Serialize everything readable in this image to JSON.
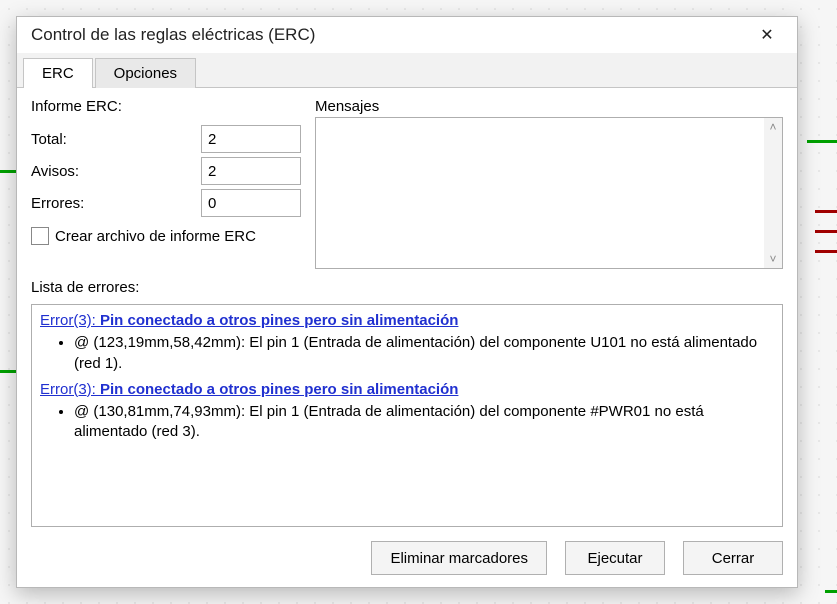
{
  "window": {
    "title": "Control de las reglas eléctricas (ERC)"
  },
  "tabs": {
    "erc": "ERC",
    "opciones": "Opciones"
  },
  "report": {
    "legend": "Informe ERC:",
    "total_label": "Total:",
    "total_value": "2",
    "avisos_label": "Avisos:",
    "avisos_value": "2",
    "errores_label": "Errores:",
    "errores_value": "0",
    "create_file_label": "Crear archivo de informe ERC"
  },
  "messages": {
    "label": "Mensajes"
  },
  "error_list": {
    "label": "Lista de errores:",
    "items": [
      {
        "link_prefix": "Error(3): ",
        "link_title": "Pin conectado a otros pines pero sin alimentación",
        "detail": "@ (123,19mm,58,42mm): El pin 1 (Entrada de alimentación) del componente U101 no está alimentado (red 1)."
      },
      {
        "link_prefix": "Error(3): ",
        "link_title": "Pin conectado a otros pines pero sin alimentación",
        "detail": "@ (130,81mm,74,93mm): El pin 1 (Entrada de alimentación) del componente #PWR01 no está alimentado (red 3)."
      }
    ]
  },
  "buttons": {
    "clear_markers": "Eliminar marcadores",
    "run": "Ejecutar",
    "close": "Cerrar"
  }
}
